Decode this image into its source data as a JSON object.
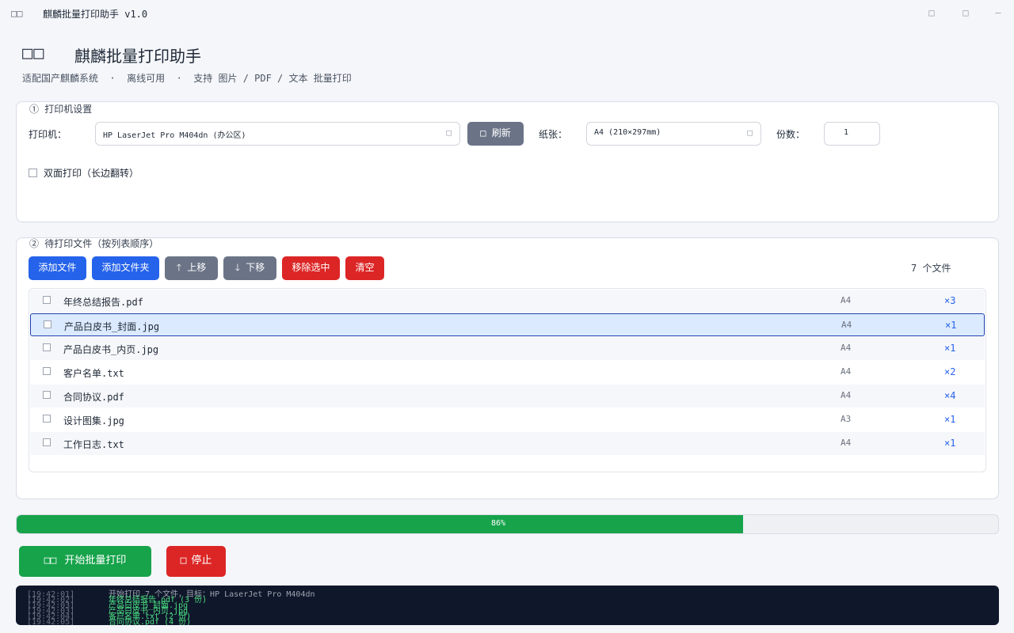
{
  "titlebar": {
    "icon": "□□",
    "title": "麒麟批量打印助手 v1.0",
    "minimize": "□",
    "maximize": "□",
    "close": "—"
  },
  "header": {
    "icon": "□□",
    "title": "麒麟批量打印助手",
    "subtitle": "适配国产麒麟系统  ·  离线可用  ·  支持 图片 / PDF / 文本 批量打印"
  },
  "printer_settings": {
    "group_title": "① 打印机设置",
    "printer_label": "打印机：",
    "printer_value": "HP LaserJet Pro M404dn (办公区)",
    "printer_arrow": "□",
    "refresh_icon": "□",
    "refresh_label": "刷新",
    "paper_label": "纸张：",
    "paper_value": "A4 (210×297mm)",
    "paper_arrow": "□",
    "copies_label": "份数：",
    "copies_value": "1",
    "duplex_label": "双面打印（长边翻转）"
  },
  "file_list": {
    "group_title": "② 待打印文件（按列表顺序）",
    "add_file": "添加文件",
    "add_folder": "添加文件夹",
    "move_up_icon": "🡑",
    "move_up": "上移",
    "move_down_icon": "🡓",
    "move_down": "下移",
    "remove_selected": "移除选中",
    "clear": "清空",
    "count_text": "7 个文件",
    "files": [
      {
        "name": "年终总结报告.pdf",
        "paper": "A4",
        "copies": "×3"
      },
      {
        "name": "产品白皮书_封面.jpg",
        "paper": "A4",
        "copies": "×1"
      },
      {
        "name": "产品白皮书_内页.jpg",
        "paper": "A4",
        "copies": "×1"
      },
      {
        "name": "客户名单.txt",
        "paper": "A4",
        "copies": "×2"
      },
      {
        "name": "合同协议.pdf",
        "paper": "A4",
        "copies": "×4"
      },
      {
        "name": "设计图集.jpg",
        "paper": "A3",
        "copies": "×1"
      },
      {
        "name": "工作日志.txt",
        "paper": "A4",
        "copies": "×1"
      }
    ],
    "selected_index": 1
  },
  "progress": {
    "value": 0.86,
    "text": "86%",
    "fill_color": "#16a34a"
  },
  "actions": {
    "start_icon": "□□",
    "start_label": "开始批量打印",
    "stop_icon": "□",
    "stop_label": "停止"
  },
  "log": [
    {
      "time": "[19:42:01]",
      "msg": "开始打印 7 个文件，目标：HP LaserJet Pro M404dn",
      "color": "#9ca3af"
    },
    {
      "time": "[19:42:02]",
      "msg": "年终总结报告.pdf (3 份)",
      "color": "#4ade80"
    },
    {
      "time": "[19:42:03]",
      "msg": "产品白皮书_封面.jpg",
      "color": "#4ade80"
    },
    {
      "time": "[19:42:03]",
      "msg": "产品白皮书_内页.jpg",
      "color": "#4ade80"
    },
    {
      "time": "[19:42:04]",
      "msg": "客户名单.txt (2 份)",
      "color": "#4ade80"
    },
    {
      "time": "[19:42:05]",
      "msg": "合同协议.pdf (4 份)",
      "color": "#4ade80"
    }
  ]
}
